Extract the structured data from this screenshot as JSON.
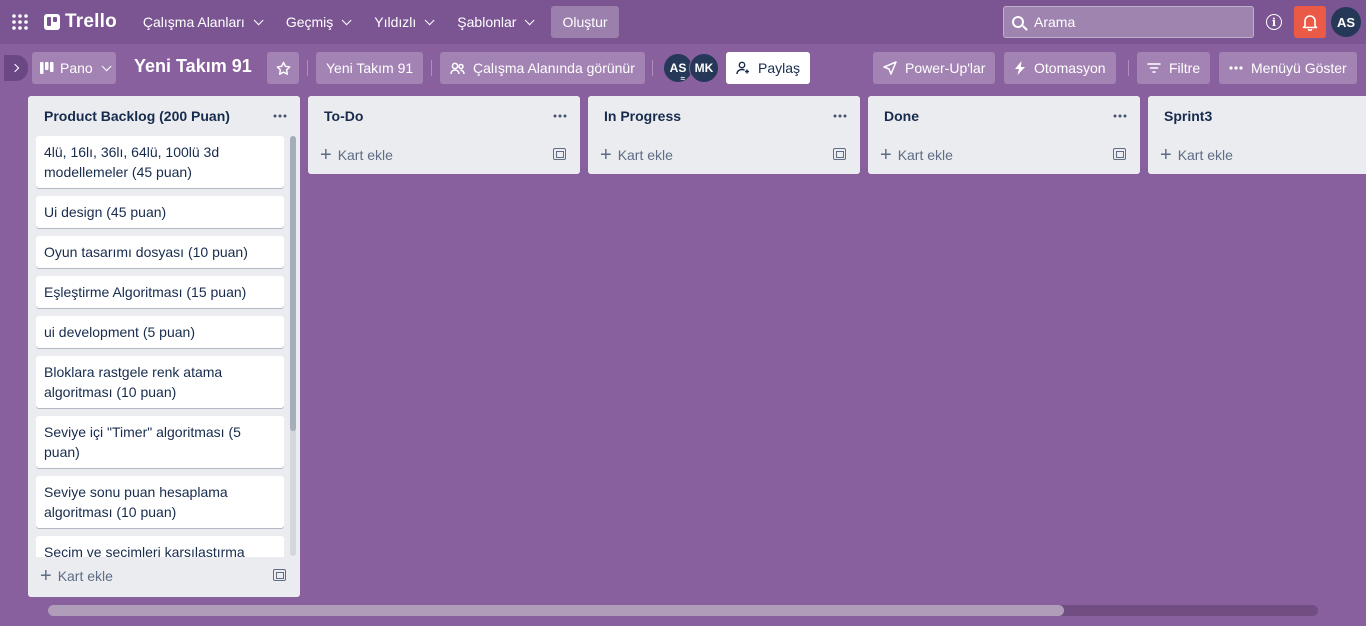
{
  "topbar": {
    "logo": "Trello",
    "menus": [
      {
        "label": "Çalışma Alanları"
      },
      {
        "label": "Geçmiş"
      },
      {
        "label": "Yıldızlı"
      },
      {
        "label": "Şablonlar"
      }
    ],
    "create_label": "Oluştur",
    "search_placeholder": "Arama",
    "avatar": "AS"
  },
  "board": {
    "view_label": "Pano",
    "title": "Yeni Takım 91",
    "workspace_label": "Yeni Takım 91",
    "visibility_label": "Çalışma Alanında görünür",
    "members": [
      "AS",
      "MK"
    ],
    "share_label": "Paylaş",
    "powerups_label": "Power-Up'lar",
    "automation_label": "Otomasyon",
    "filter_label": "Filtre",
    "menu_label": "Menüyü Göster"
  },
  "lists": [
    {
      "title": "Product Backlog (200 Puan)",
      "cards": [
        "4lü, 16lı, 36lı, 64lü, 100lü 3d modellemeler (45 puan)",
        "Ui design (45 puan)",
        "Oyun tasarımı dosyası (10 puan)",
        "Eşleştirme Algoritması (15 puan)",
        "ui development (5 puan)",
        "Bloklara rastgele renk atama algoritması (10 puan)",
        "Seviye içi \"Timer\" algoritması (5 puan)",
        "Seviye sonu puan hesaplama algoritması (10 puan)",
        "Seçim ve seçimleri karşılaştırma"
      ],
      "add_label": "Kart ekle"
    },
    {
      "title": "To-Do",
      "cards": [],
      "add_label": "Kart ekle"
    },
    {
      "title": "In Progress",
      "cards": [],
      "add_label": "Kart ekle"
    },
    {
      "title": "Done",
      "cards": [],
      "add_label": "Kart ekle"
    },
    {
      "title": "Sprint3",
      "cards": [],
      "add_label": "Kart ekle"
    }
  ],
  "colors": {
    "board_bg": "#89609e",
    "header_bg": "#7a5592",
    "notification": "#eb5a46",
    "avatar": "#253858"
  },
  "icons": [
    "apps-grid-icon",
    "trello-logo-icon",
    "search-icon",
    "info-icon",
    "bell-icon",
    "board-icon",
    "star-icon",
    "people-icon",
    "add-user-icon",
    "rocket-icon",
    "bolt-icon",
    "filter-icon",
    "more-icon",
    "template-icon",
    "plus-icon"
  ]
}
